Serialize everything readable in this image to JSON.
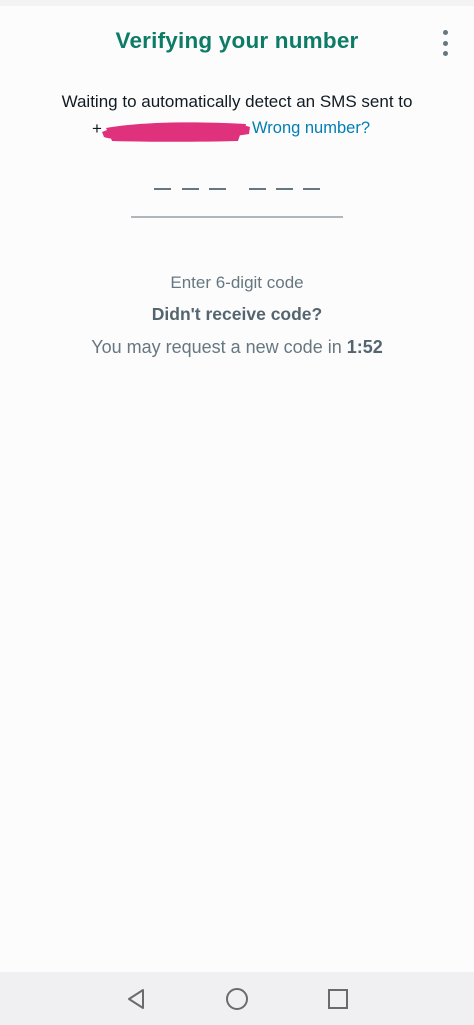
{
  "header": {
    "title": "Verifying your number",
    "menu_icon": "more-vert-icon"
  },
  "message": {
    "waiting_text": "Waiting to automatically detect an SMS sent to",
    "phone_prefix": "+",
    "wrong_number_link": "Wrong number?"
  },
  "code_input": {
    "digit_count": 6
  },
  "hint": {
    "enter_code": "Enter 6-digit code",
    "didnt_receive": "Didn't receive code?",
    "resend_text": "You may request a new code in",
    "timer": "1:52"
  },
  "navigation": {
    "back_icon": "back-triangle-icon",
    "home_icon": "home-circle-icon",
    "recents_icon": "recents-square-icon"
  },
  "colors": {
    "title": "#0d7c66",
    "link": "#027eb5",
    "redaction": "#e0317d"
  }
}
